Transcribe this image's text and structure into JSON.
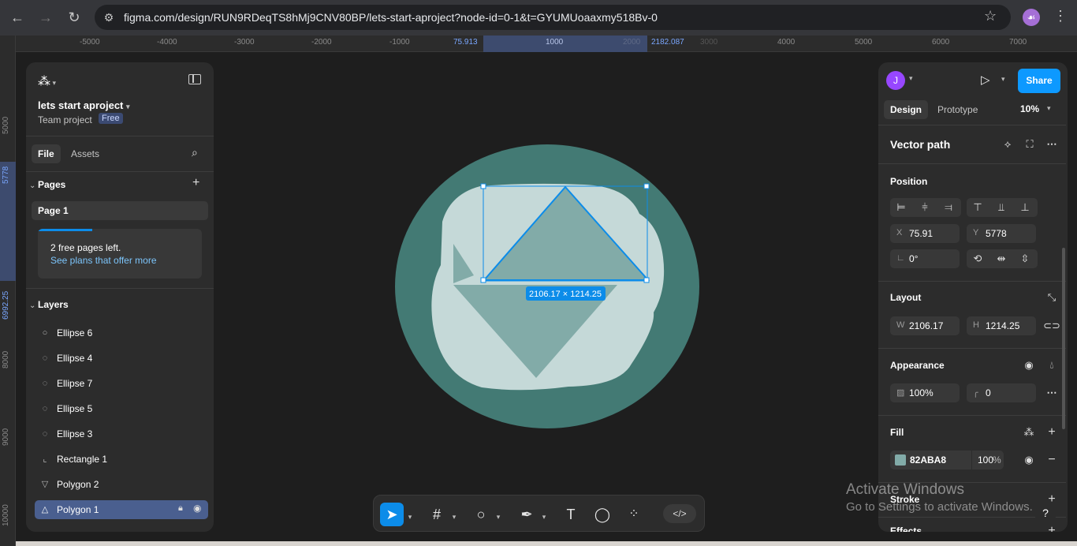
{
  "browser": {
    "url": "figma.com/design/RUN9RDeqTS8hMj9CNV80BP/lets-start-aproject?node-id=0-1&t=GYUMUoaaxmy518Bv-0",
    "profile_initial": "☙"
  },
  "rulers": {
    "horizontal": [
      "-5000",
      "-4000",
      "-3000",
      "-2000",
      "-1000",
      "75.913",
      "1000",
      "2000",
      "2182.087",
      "3000",
      "4000",
      "5000",
      "6000",
      "7000"
    ],
    "vertical": [
      "5000",
      "5778",
      "6992.25",
      "8000",
      "9000",
      "10000"
    ]
  },
  "left_panel": {
    "project_title": "lets start aproject",
    "team": "Team project",
    "plan_badge": "Free",
    "tabs": {
      "file": "File",
      "assets": "Assets"
    },
    "pages_heading": "Pages",
    "pages": [
      "Page 1"
    ],
    "upsell": {
      "line1": "2 free pages left.",
      "line2": "See plans that offer more",
      "progress": 0.33
    },
    "layers_heading": "Layers",
    "layers": [
      {
        "name": "Ellipse 6",
        "icon": "ellipse-icon"
      },
      {
        "name": "Ellipse 4",
        "icon": "arc-icon"
      },
      {
        "name": "Ellipse 7",
        "icon": "arc-icon"
      },
      {
        "name": "Ellipse 5",
        "icon": "arc-icon"
      },
      {
        "name": "Ellipse 3",
        "icon": "arc-icon"
      },
      {
        "name": "Rectangle 1",
        "icon": "vector-icon"
      },
      {
        "name": "Polygon 2",
        "icon": "triangle-down-icon"
      },
      {
        "name": "Polygon 1",
        "icon": "triangle-up-icon",
        "selected": true
      }
    ]
  },
  "canvas": {
    "selection_size": "2106.17 × 1214.25",
    "colors": {
      "bg": "#1e1e1e",
      "circle": "#437a74",
      "blob": "#c5d9d8",
      "triangle": "#82aba8",
      "selection": "#0c8ce9"
    }
  },
  "toolbar": {
    "tools": [
      "move-tool",
      "frame-tool",
      "shape-tool",
      "pen-tool",
      "text-tool",
      "comment-tool",
      "actions-tool"
    ],
    "code_label": "</>"
  },
  "right_panel": {
    "avatar_initial": "J",
    "share_label": "Share",
    "tabs": {
      "design": "Design",
      "prototype": "Prototype"
    },
    "zoom": "10%",
    "layer_type": "Vector path",
    "position": {
      "heading": "Position",
      "x_label": "X",
      "x": "75.91",
      "y_label": "Y",
      "y": "5778",
      "rotation": "0°"
    },
    "layout": {
      "heading": "Layout",
      "w_label": "W",
      "w": "2106.17",
      "h_label": "H",
      "h": "1214.25"
    },
    "appearance": {
      "heading": "Appearance",
      "opacity": "100%",
      "radius": "0"
    },
    "fill": {
      "heading": "Fill",
      "hex": "82ABA8",
      "opacity": "100",
      "percent": "%",
      "swatch": "#82aba8"
    },
    "stroke_heading": "Stroke",
    "effects_heading": "Effects"
  },
  "watermark": {
    "line1": "Activate Windows",
    "line2": "Go to Settings to activate Windows."
  }
}
